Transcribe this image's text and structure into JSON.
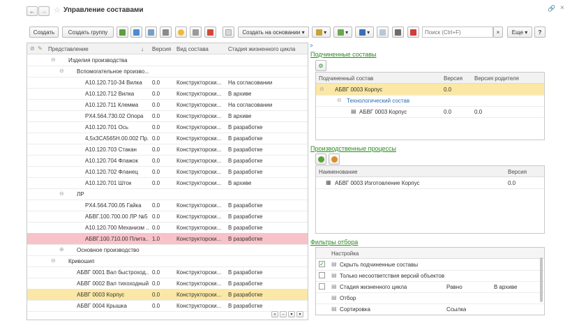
{
  "window": {
    "title": "Управление составами",
    "back": "←",
    "forward": "→",
    "star": "☆",
    "link": "🔗",
    "close": "×"
  },
  "toolbar": {
    "create": "Создать",
    "create_group": "Создать группу",
    "create_on_basis": "Создать на основании",
    "search_placeholder": "Поиск (Ctrl+F)",
    "clear": "×",
    "more": "Еще",
    "help": "?"
  },
  "left_table": {
    "headers": [
      "Представление",
      "Версия",
      "Вид состава",
      "Стадия жизненного цикла"
    ],
    "sort_arrow": "↓",
    "rows": [
      {
        "indent": 1,
        "icon": "folder",
        "expand": "⊖",
        "name": "Изделия производства",
        "version": "",
        "kind": "",
        "stage": "",
        "state": ""
      },
      {
        "indent": 2,
        "icon": "folder",
        "expand": "⊖",
        "name": "Вспомогательное произво...",
        "version": "",
        "kind": "",
        "stage": "",
        "state": ""
      },
      {
        "indent": 3,
        "icon": "assembly",
        "expand": "",
        "name": "A10.120.710-34 Вилка",
        "version": "0.0",
        "kind": "Конструкторски...",
        "stage": "На согласовании",
        "state": ""
      },
      {
        "indent": 3,
        "icon": "part",
        "expand": "",
        "name": "A10.120.712 Вилка",
        "version": "0.0",
        "kind": "Конструкторски...",
        "stage": "В архиве",
        "state": ""
      },
      {
        "indent": 3,
        "icon": "part",
        "expand": "",
        "name": "A10.120.711 Клемма",
        "version": "0.0",
        "kind": "Конструкторски...",
        "stage": "На согласовании",
        "state": ""
      },
      {
        "indent": 3,
        "icon": "part",
        "expand": "",
        "name": "PX4.564.730.02 Опора",
        "version": "0.0",
        "kind": "Конструкторски...",
        "stage": "В архиве",
        "state": ""
      },
      {
        "indent": 3,
        "icon": "assembly",
        "expand": "",
        "name": "A10.120.701 Ось",
        "version": "0.0",
        "kind": "Конструкторски...",
        "stage": "В разработке",
        "state": ""
      },
      {
        "indent": 3,
        "icon": "part",
        "expand": "",
        "name": "4,5x3CA565H.00.002 Пр...",
        "version": "0.0",
        "kind": "Конструкторски...",
        "stage": "В разработке",
        "state": ""
      },
      {
        "indent": 3,
        "icon": "part",
        "expand": "",
        "name": "A10.120.703 Стакан",
        "version": "0.0",
        "kind": "Конструкторски...",
        "stage": "В разработке",
        "state": ""
      },
      {
        "indent": 3,
        "icon": "part",
        "expand": "",
        "name": "A10.120.704 Флажок",
        "version": "0.0",
        "kind": "Конструкторски...",
        "stage": "В разработке",
        "state": ""
      },
      {
        "indent": 3,
        "icon": "part",
        "expand": "",
        "name": "A10.120.702 Фланец",
        "version": "0.0",
        "kind": "Конструкторски...",
        "stage": "В разработке",
        "state": ""
      },
      {
        "indent": 3,
        "icon": "part",
        "expand": "",
        "name": "A10.120.701 Шток",
        "version": "0.0",
        "kind": "Конструкторски...",
        "stage": "В архиве",
        "state": ""
      },
      {
        "indent": 2,
        "icon": "folder",
        "expand": "⊖",
        "name": "ЛР",
        "version": "",
        "kind": "",
        "stage": "",
        "state": ""
      },
      {
        "indent": 3,
        "icon": "part",
        "expand": "",
        "name": "PX4.564.700.05 Гайка",
        "version": "0.0",
        "kind": "Конструкторски...",
        "stage": "В разработке",
        "state": ""
      },
      {
        "indent": 3,
        "icon": "assembly",
        "expand": "",
        "name": "АБВГ.100.700.00 ЛР №5",
        "version": "0.0",
        "kind": "Конструкторски...",
        "stage": "В разработке",
        "state": ""
      },
      {
        "indent": 3,
        "icon": "assembly",
        "expand": "",
        "name": "A10.120.700 Механизм ...",
        "version": "0.0",
        "kind": "Конструкторски...",
        "stage": "В разработке",
        "state": ""
      },
      {
        "indent": 3,
        "icon": "assembly",
        "expand": "",
        "name": "АБВГ.100.710.00 Плита...",
        "version": "1.0",
        "kind": "Конструкторски...",
        "stage": "В разработке",
        "state": "red"
      },
      {
        "indent": 2,
        "icon": "folder",
        "expand": "⊕",
        "name": "Основное производство",
        "version": "",
        "kind": "",
        "stage": "",
        "state": ""
      },
      {
        "indent": 1,
        "icon": "folder",
        "expand": "⊖",
        "name": "Кривошип",
        "version": "",
        "kind": "",
        "stage": "",
        "state": ""
      },
      {
        "indent": 2,
        "icon": "part",
        "expand": "",
        "name": "АБВГ 0001 Вал быстроход...",
        "version": "0.0",
        "kind": "Конструкторски...",
        "stage": "В разработке",
        "state": ""
      },
      {
        "indent": 2,
        "icon": "part",
        "expand": "",
        "name": "АБВГ 0002 Вал тихоходный",
        "version": "0.0",
        "kind": "Конструкторски...",
        "stage": "В разработке",
        "state": ""
      },
      {
        "indent": 2,
        "icon": "part",
        "expand": "",
        "name": "АБВГ 0003 Корпус",
        "version": "0.0",
        "kind": "Конструкторски...",
        "stage": "В разработке",
        "state": "selected"
      },
      {
        "indent": 2,
        "icon": "part",
        "expand": "",
        "name": "АБВГ 0004 Крышка",
        "version": "0.0",
        "kind": "Конструкторски...",
        "stage": "В разработке",
        "state": ""
      }
    ],
    "scroll_buttons": [
      "«",
      "–",
      "▾",
      "▾"
    ]
  },
  "subordinate": {
    "title": "Подчиненные составы",
    "headers": [
      "Подчиненный состав",
      "Версия",
      "Версия родителя"
    ],
    "rows": [
      {
        "name": "АБВГ 0003 Корпус",
        "version": "0.0",
        "parent": "",
        "state": "selected",
        "link": false
      },
      {
        "name": "Технологический состав",
        "version": "",
        "parent": "",
        "state": "",
        "link": true
      },
      {
        "name": "АБВГ 0003 Корпус",
        "version": "0.0",
        "parent": "0.0",
        "state": "",
        "link": false
      }
    ]
  },
  "processes": {
    "title": "Производственные процессы",
    "headers": [
      "Наименование",
      "Версия"
    ],
    "rows": [
      {
        "name": "АБВГ 0003 Изготовление Корпус",
        "version": "0.0"
      }
    ]
  },
  "filters": {
    "title": "Фильтры отбора",
    "header": "Настройка",
    "rows": [
      {
        "checkbox": true,
        "checked": true,
        "label": "Скрыть подчиненные составы",
        "condition": "",
        "value": ""
      },
      {
        "checkbox": true,
        "checked": false,
        "label": "Только несоответствия версий объектов",
        "condition": "",
        "value": ""
      },
      {
        "checkbox": true,
        "checked": false,
        "label": "Стадия жизненного цикла",
        "condition": "Равно",
        "value": "В архиве"
      },
      {
        "checkbox": false,
        "checked": false,
        "label": "Отбор",
        "condition": "",
        "value": ""
      },
      {
        "checkbox": false,
        "checked": false,
        "label": "Сортировка",
        "condition": "Ссылка",
        "value": ""
      }
    ]
  },
  "colors": {
    "link_green": "#2a8a1f",
    "selected_row": "#fbe8a6",
    "error_row": "#f7c3c9"
  }
}
